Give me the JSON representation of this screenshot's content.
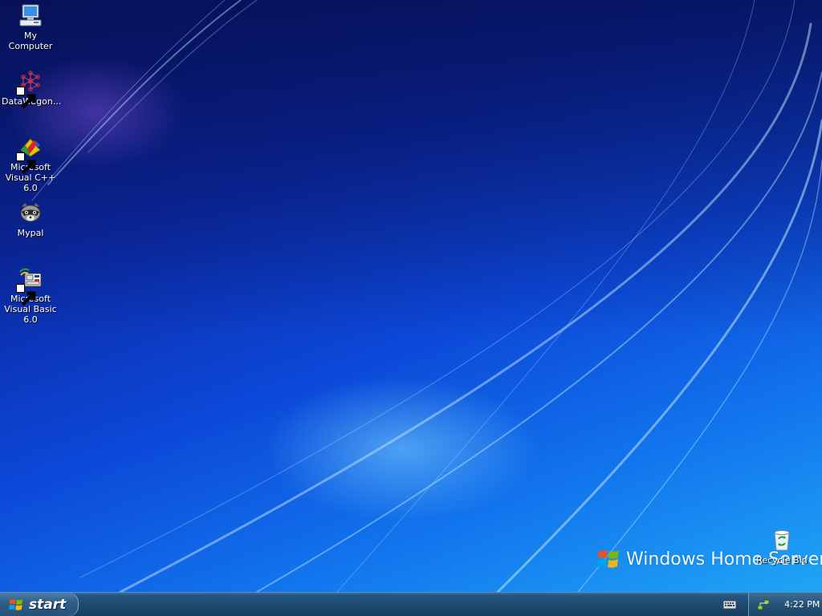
{
  "desktop": {
    "icons": [
      {
        "label": "My Computer",
        "icon": "my-computer-icon",
        "shortcut": false
      },
      {
        "label": "DataWagon...",
        "icon": "datawagon-icon",
        "shortcut": true
      },
      {
        "label": "Microsoft Visual C++ 6.0",
        "icon": "visual-cpp-icon",
        "shortcut": true
      },
      {
        "label": "Mypal",
        "icon": "mypal-raccoon-icon",
        "shortcut": true
      },
      {
        "label": "Microsoft Visual Basic 6.0",
        "icon": "visual-basic-icon",
        "shortcut": true
      },
      {
        "label": "Recycle Bin",
        "icon": "recycle-bin-icon",
        "shortcut": false
      }
    ],
    "wallpaper_brand": "Windows Home Server",
    "wallpaper_brand_icon": "windows-flag-icon"
  },
  "taskbar": {
    "start_label": "start",
    "start_icon": "windows-flag-icon",
    "tray_icons": [
      "keyboard-icon",
      "network-icon"
    ],
    "clock": "4:22 PM"
  },
  "colors": {
    "wallpaper_dark": "#0a1a7a",
    "wallpaper_light": "#1fa6f5",
    "taskbar": "#1e4a72",
    "icon_text": "#ffffff"
  }
}
